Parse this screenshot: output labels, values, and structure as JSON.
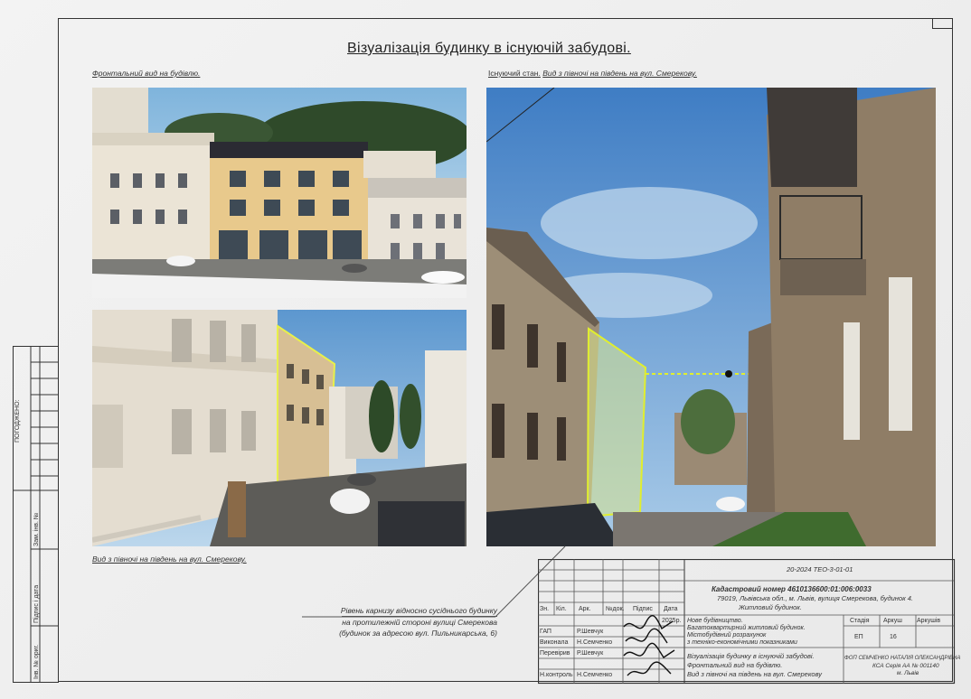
{
  "title": "Візуалізація будинку в існуючій забудові.",
  "captions": {
    "front": "Фронтальний вид на будівлю.",
    "existing_prefix": "Існуючий стан.",
    "existing_rest": "Вид з півночі на південь на вул. Смерекову.",
    "street": "Вид з півночі на південь на вул. Смерекову."
  },
  "annotation": {
    "line1": "Рівень карнизу відносно сусіднього будинку",
    "line2": "на протилежній стороні вулиці Смерекова",
    "line3": "(будинок за адресою вул. Пильникарська, 6)"
  },
  "side_stamp": {
    "approved": "ПОГОДЖЕНО:",
    "replace_inv": "Зам. інв. №",
    "sign_date": "Підпис і дата",
    "inv_orig": "Інв. № ориг."
  },
  "title_block": {
    "doc_code": "20-2024  ТЕО-3-01-01",
    "cadastral": "Кадастровий номер  4610136600:01:006:0033",
    "address": "79019, Львівська обл., м. Львів, вулиця Смерекова, будинок 4.",
    "building_type": "Житловий будинок.",
    "header_cells": [
      "Зн.",
      "Кіл.",
      "Арк.",
      "№док.",
      "Підпис",
      "Дата"
    ],
    "year": "2025р.",
    "roles": [
      {
        "role": "ГАП",
        "name": "Р.Шевчук"
      },
      {
        "role": "Виконала",
        "name": "Н.Семченко"
      },
      {
        "role": "Перевірив",
        "name": "Р.Шевчук"
      },
      {
        "role": "",
        "name": ""
      },
      {
        "role": "Н.контроль",
        "name": "Н.Семченко"
      }
    ],
    "project_lines": [
      "Нове будівництво.",
      "Багатоквартирний житловий будинок.",
      "Містобудівний розрахунок",
      "з техніко-економічними показниками"
    ],
    "stage_headers": [
      "Стадія",
      "Аркуш",
      "Аркушів"
    ],
    "stage_values": [
      "ЕП",
      "16",
      ""
    ],
    "sheet_lines": [
      "Візуалізація будинку в існуючій забудові.",
      "Фронтальний вид на будівлю.",
      "Вид з півночі на південь на вул. Смерекову"
    ],
    "company_lines": [
      "ФОП СЕМЧЕНКО НАТАЛІЯ ОЛЕКСАНДРІВНА",
      "КСА Серія АА № 001140",
      "м. Львів"
    ]
  }
}
